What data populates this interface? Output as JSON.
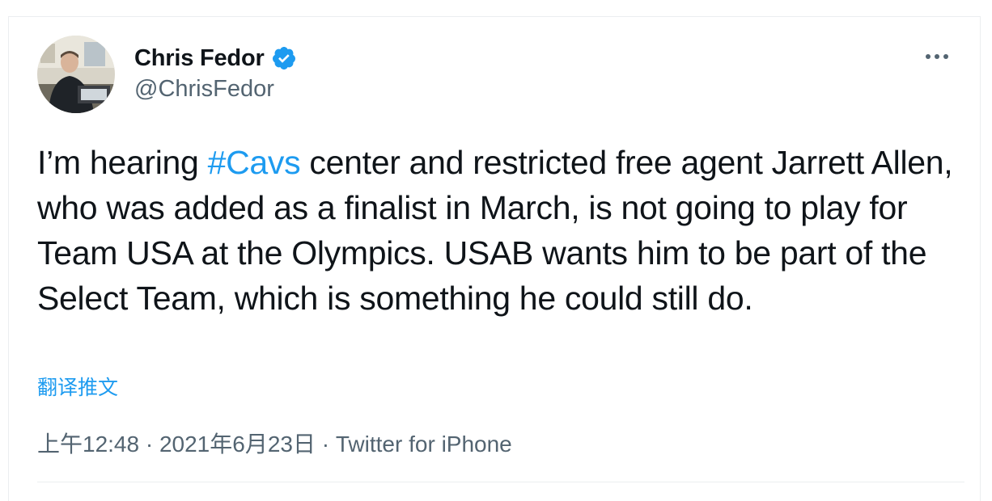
{
  "tweet": {
    "display_name": "Chris Fedor",
    "handle": "@ChrisFedor",
    "text_before": "I’m hearing ",
    "hashtag": "#Cavs",
    "text_after": " center and restricted free agent Jarrett Allen, who was added as a finalist in March, is not going to play for Team USA at the Olympics. USAB wants him to be part of the Select Team, which is something he could still do.",
    "translate_label": "翻译推文",
    "time": "上午12:48",
    "separator": " · ",
    "date": "2021年6月23日",
    "source": "Twitter for iPhone"
  },
  "icons": {
    "verified": "verified-badge-icon",
    "more": "more-options-icon"
  },
  "colors": {
    "link": "#1d9bf0",
    "secondary_text": "#536471",
    "primary_text": "#0f1419",
    "divider": "#ebeef0"
  }
}
